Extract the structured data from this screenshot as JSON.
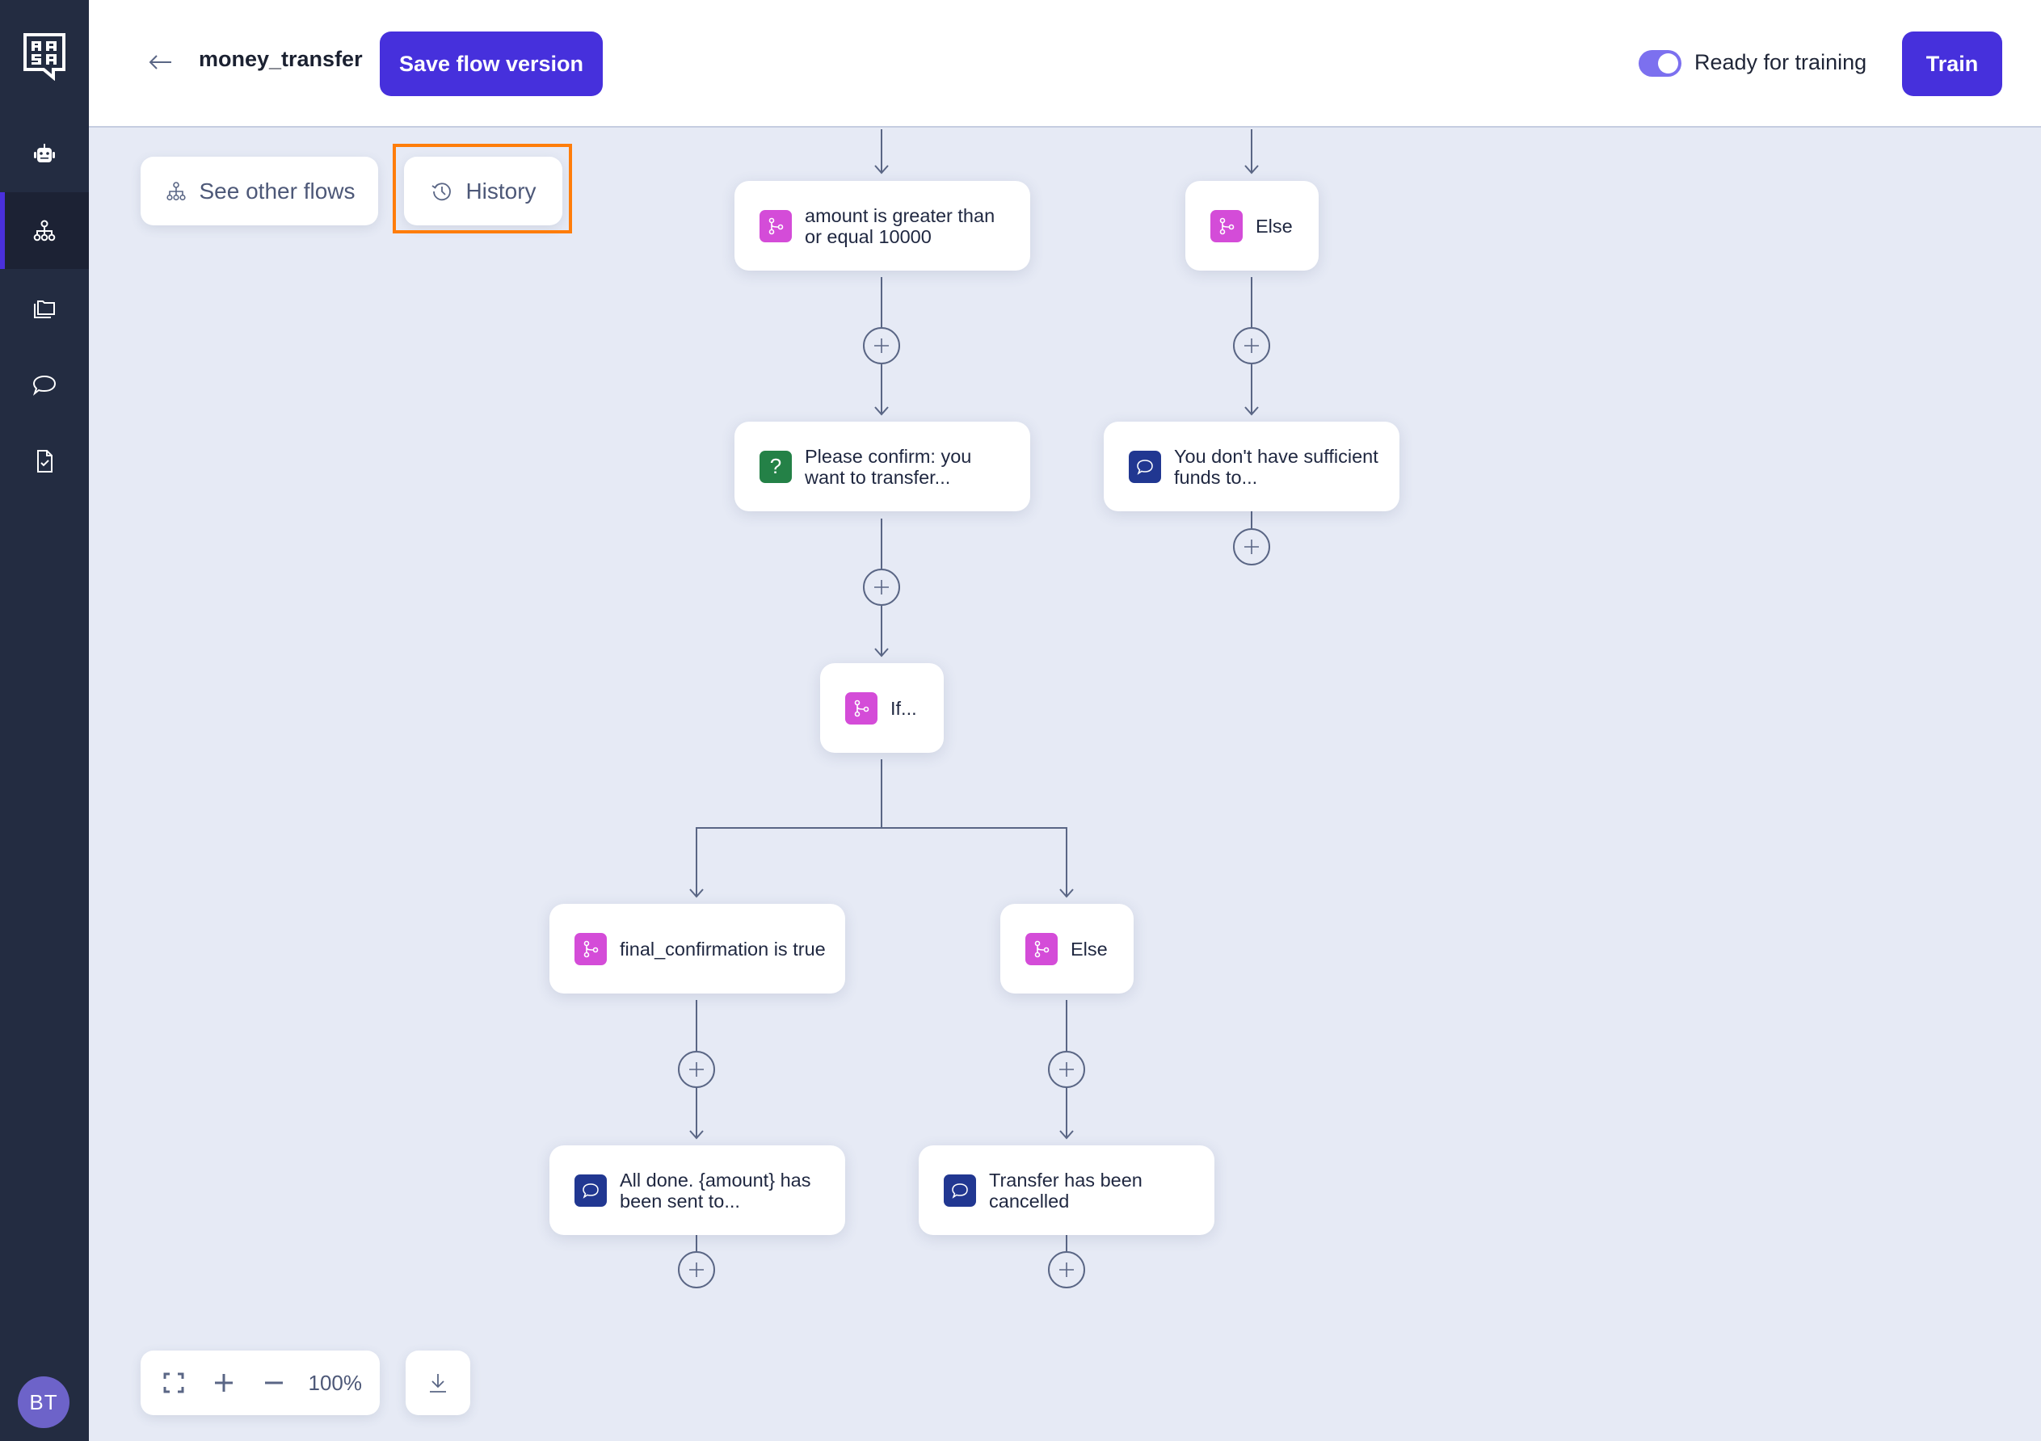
{
  "sidebar": {
    "logo_text": "RASA",
    "items": [
      {
        "name": "assistant",
        "icon": "robot-icon",
        "active": false
      },
      {
        "name": "flows",
        "icon": "flow-tree-icon",
        "active": true
      },
      {
        "name": "content",
        "icon": "folder-icon",
        "active": false
      },
      {
        "name": "conversations",
        "icon": "chat-bubble-icon",
        "active": false
      },
      {
        "name": "tests",
        "icon": "file-check-icon",
        "active": false
      }
    ],
    "avatar_initials": "BT"
  },
  "header": {
    "back_icon": "arrow-left-icon",
    "flow_name": "money_transfer",
    "save_label": "Save flow version",
    "toggle_label": "Ready for training",
    "toggle_on": true,
    "train_label": "Train"
  },
  "canvas_toolbar": {
    "see_other_flows_label": "See other flows",
    "history_label": "History"
  },
  "zoom_controls": {
    "fit_icon": "fullscreen-icon",
    "zoom_in_icon": "plus-icon",
    "zoom_out_icon": "minus-icon",
    "zoom_level": "100%",
    "download_icon": "download-icon"
  },
  "flow": {
    "nodes": [
      {
        "id": "cond_amount",
        "type": "branch",
        "text": "amount is greater than or equal 10000"
      },
      {
        "id": "else_top",
        "type": "branch",
        "text": "Else"
      },
      {
        "id": "confirm",
        "type": "question",
        "text": "Please confirm: you want to transfer..."
      },
      {
        "id": "insufficient",
        "type": "message",
        "text": "You don't have sufficient funds to..."
      },
      {
        "id": "if_node",
        "type": "branch",
        "text": "If..."
      },
      {
        "id": "cond_final",
        "type": "branch",
        "text": "final_confirmation is true"
      },
      {
        "id": "else_bottom",
        "type": "branch",
        "text": "Else"
      },
      {
        "id": "all_done",
        "type": "message",
        "text": "All done. {amount} has been sent to..."
      },
      {
        "id": "cancelled",
        "type": "message",
        "text": "Transfer has been cancelled"
      }
    ]
  },
  "colors": {
    "primary": "#4630dc",
    "highlight": "#ff7d0a",
    "branch_icon": "#d44cd8",
    "question_icon": "#248147",
    "message_icon": "#213791",
    "sidebar_bg": "#232c41",
    "canvas_bg": "#e6eaf5",
    "edge": "#5a6685"
  }
}
